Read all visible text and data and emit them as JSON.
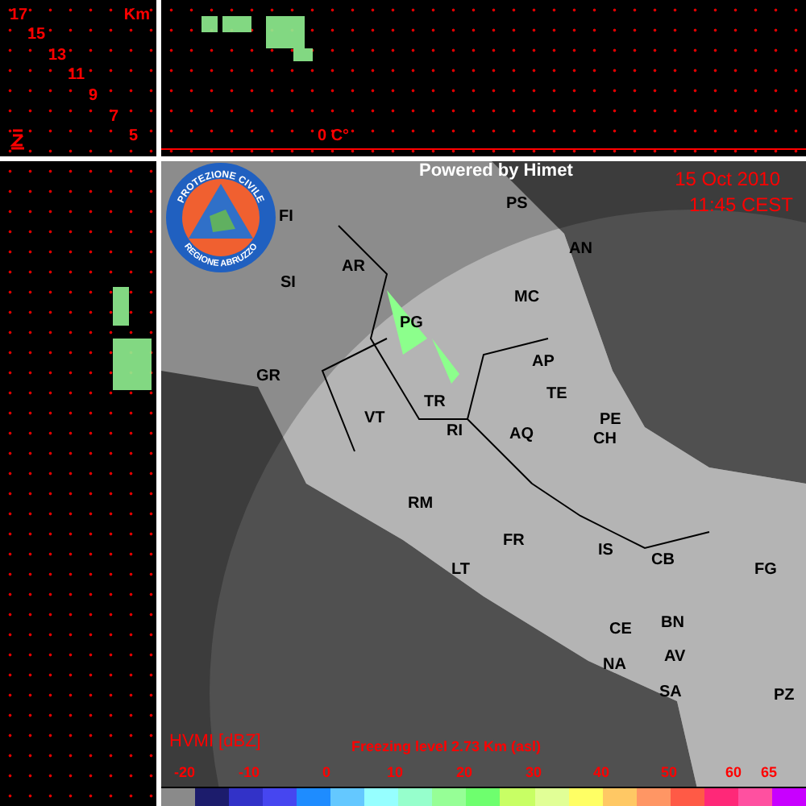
{
  "height_panel": {
    "unit": "Km",
    "ticks": [
      "17",
      "15",
      "13",
      "11",
      "9",
      "7",
      "5"
    ]
  },
  "top_section": {
    "freezing_label": "0 C°"
  },
  "map": {
    "powered_by": "Powered by Himet",
    "date": "15 Oct 2010",
    "time": "11:45 CEST",
    "logo": {
      "top_text": "PROTEZIONE CIVILE",
      "bottom_text": "REGIONE ABRUZZO"
    },
    "cities": [
      {
        "label": "FI"
      },
      {
        "label": "PS"
      },
      {
        "label": "AN"
      },
      {
        "label": "SI"
      },
      {
        "label": "AR"
      },
      {
        "label": "MC"
      },
      {
        "label": "PG"
      },
      {
        "label": "AP"
      },
      {
        "label": "GR"
      },
      {
        "label": "TE"
      },
      {
        "label": "TR"
      },
      {
        "label": "VT"
      },
      {
        "label": "RI"
      },
      {
        "label": "AQ"
      },
      {
        "label": "PE"
      },
      {
        "label": "CH"
      },
      {
        "label": "RM"
      },
      {
        "label": "FR"
      },
      {
        "label": "LT"
      },
      {
        "label": "IS"
      },
      {
        "label": "CB"
      },
      {
        "label": "FG"
      },
      {
        "label": "CE"
      },
      {
        "label": "BN"
      },
      {
        "label": "NA"
      },
      {
        "label": "AV"
      },
      {
        "label": "SA"
      },
      {
        "label": "PZ"
      }
    ]
  },
  "legend": {
    "title": "HVMI [dBZ]",
    "freezing_level": "Freezing level  2.73 Km (asl)",
    "ticks": [
      "-20",
      "-10",
      "0",
      "10",
      "20",
      "30",
      "40",
      "50",
      "60",
      "65"
    ],
    "swatches": [
      {
        "color": "#8a8a8a"
      },
      {
        "color": "#1c1c6c"
      },
      {
        "color": "#3232c8"
      },
      {
        "color": "#4646f0"
      },
      {
        "color": "#1e8cff"
      },
      {
        "color": "#64c8ff"
      },
      {
        "color": "#96ffff"
      },
      {
        "color": "#96ffcc"
      },
      {
        "color": "#96ff96"
      },
      {
        "color": "#6eff6e"
      },
      {
        "color": "#c8ff64"
      },
      {
        "color": "#e1ff96"
      },
      {
        "color": "#ffff64"
      },
      {
        "color": "#ffc864"
      },
      {
        "color": "#ff9664"
      },
      {
        "color": "#ff5a46"
      },
      {
        "color": "#ff2878"
      },
      {
        "color": "#ff50a0"
      },
      {
        "color": "#c800ff"
      }
    ]
  }
}
